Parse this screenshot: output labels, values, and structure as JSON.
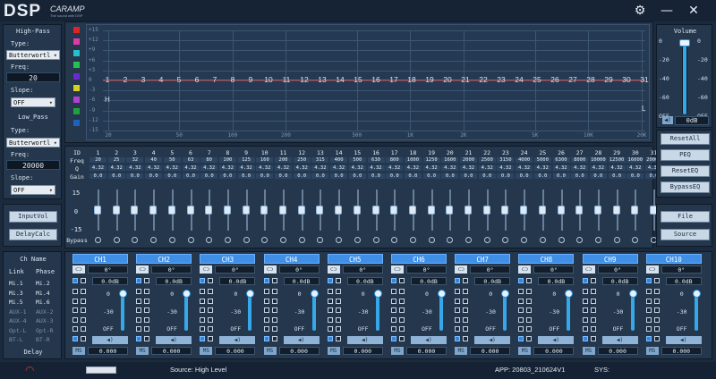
{
  "app": {
    "logo": "DSP",
    "brand": "CARAMP",
    "tagline": "The sound with DSP",
    "settings_icon": "gear-icon",
    "minimize_icon": "minimize-icon",
    "close_icon": "close-icon"
  },
  "highpass": {
    "title": "High-Pass",
    "type_label": "Type:",
    "type_value": "Butterwortl",
    "freq_label": "Freq:",
    "freq_value": "20",
    "slope_label": "Slope:",
    "slope_value": "OFF"
  },
  "lowpass": {
    "title": "Low_Pass",
    "type_label": "Type:",
    "type_value": "Butterwortl",
    "freq_label": "Freq:",
    "freq_value": "20000",
    "slope_label": "Slope:",
    "slope_value": "OFF"
  },
  "left_buttons": {
    "inputvol": "InputVol",
    "delaycalc": "DelayCalc"
  },
  "graph": {
    "y_ticks": [
      "+15",
      "+12",
      "+9",
      "+6",
      "+3",
      "0",
      "-3",
      "-6",
      "-9",
      "-12",
      "-15"
    ],
    "x_ticks": [
      "20",
      "50",
      "100",
      "200",
      "500",
      "1K",
      "2K",
      "5K",
      "10K",
      "20K"
    ],
    "band_markers": [
      "1",
      "2",
      "3",
      "4",
      "5",
      "6",
      "7",
      "8",
      "9",
      "10",
      "11",
      "12",
      "13",
      "14",
      "15",
      "16",
      "17",
      "18",
      "19",
      "20",
      "21",
      "22",
      "23",
      "24",
      "25",
      "26",
      "27",
      "28",
      "29",
      "30",
      "31"
    ],
    "hp_marker": "H",
    "lp_marker": "L",
    "curve_color": "#d9463e",
    "legend_colors": [
      "#e02424",
      "#e03aa8",
      "#28c0c8",
      "#28c050",
      "#6a2bd0",
      "#d8d020",
      "#b040d0",
      "#20a040",
      "#2060c0"
    ]
  },
  "eq_table": {
    "row_labels": [
      "ID",
      "Freq",
      "Q",
      "Gain"
    ],
    "ids": [
      "1",
      "2",
      "3",
      "4",
      "5",
      "6",
      "7",
      "8",
      "9",
      "10",
      "11",
      "12",
      "13",
      "14",
      "15",
      "16",
      "17",
      "18",
      "19",
      "20",
      "21",
      "22",
      "23",
      "24",
      "25",
      "26",
      "27",
      "28",
      "29",
      "30",
      "31"
    ],
    "freqs": [
      "20",
      "25",
      "32",
      "40",
      "50",
      "63",
      "80",
      "100",
      "125",
      "160",
      "200",
      "250",
      "315",
      "400",
      "500",
      "630",
      "800",
      "1000",
      "1250",
      "1600",
      "2000",
      "2500",
      "3150",
      "4000",
      "5000",
      "6300",
      "8000",
      "10000",
      "12500",
      "16000",
      "20000"
    ],
    "q": "4.32",
    "gain": "0.0",
    "slider_labels": [
      "15",
      "0",
      "-15"
    ],
    "bypass_label": "Bypass"
  },
  "volume": {
    "title": "Volume",
    "ticks": [
      "0",
      "-20",
      "-40",
      "-60",
      "OFF"
    ],
    "right_ticks": [
      "0",
      "-20",
      "-40",
      "-60",
      "OFF"
    ],
    "value": "0dB",
    "speaker_icon": "speaker-icon"
  },
  "right_buttons": {
    "resetall": "ResetAll",
    "peq": "PEQ",
    "reseteq": "ResetEQ",
    "bypasseq": "BypassEQ",
    "file": "File",
    "source": "Source"
  },
  "channel_section": {
    "chname": "Ch Name",
    "link": "Link",
    "phase": "Phase",
    "inputs_left": [
      "Mi.1",
      "Mi.3",
      "Mi.5",
      "AUX-1",
      "AUX-4",
      "Opt-L",
      "BT-L"
    ],
    "inputs_right": [
      "Mi.2",
      "Mi.4",
      "Mi.6",
      "AUX-2",
      "AUX-3",
      "Opt-R",
      "BT-R"
    ],
    "delay": "Delay"
  },
  "channels": [
    {
      "name": "CH1",
      "phase": "0°",
      "gain": "0.0dB",
      "delay": "0.000"
    },
    {
      "name": "CH2",
      "phase": "0°",
      "gain": "0.0dB",
      "delay": "0.000"
    },
    {
      "name": "CH3",
      "phase": "0°",
      "gain": "0.0dB",
      "delay": "0.000"
    },
    {
      "name": "CH4",
      "phase": "0°",
      "gain": "0.0dB",
      "delay": "0.000"
    },
    {
      "name": "CH5",
      "phase": "0°",
      "gain": "0.0dB",
      "delay": "0.000"
    },
    {
      "name": "CH6",
      "phase": "0°",
      "gain": "0.0dB",
      "delay": "0.000"
    },
    {
      "name": "CH7",
      "phase": "0°",
      "gain": "0.0dB",
      "delay": "0.000"
    },
    {
      "name": "CH8",
      "phase": "0°",
      "gain": "0.0dB",
      "delay": "0.000"
    },
    {
      "name": "CH9",
      "phase": "0°",
      "gain": "0.0dB",
      "delay": "0.000"
    },
    {
      "name": "CH10",
      "phase": "0°",
      "gain": "0.0dB",
      "delay": "0.000"
    }
  ],
  "channel_fader_ticks": [
    "0",
    "-30",
    "OFF"
  ],
  "channel_ms_label": "MS",
  "status": {
    "source": "Source: High Level",
    "app": "APP: 20803_210624V1",
    "sys": "SYS:",
    "wifi_icon": "wifi-icon",
    "usb_icon": "usb-icon"
  }
}
